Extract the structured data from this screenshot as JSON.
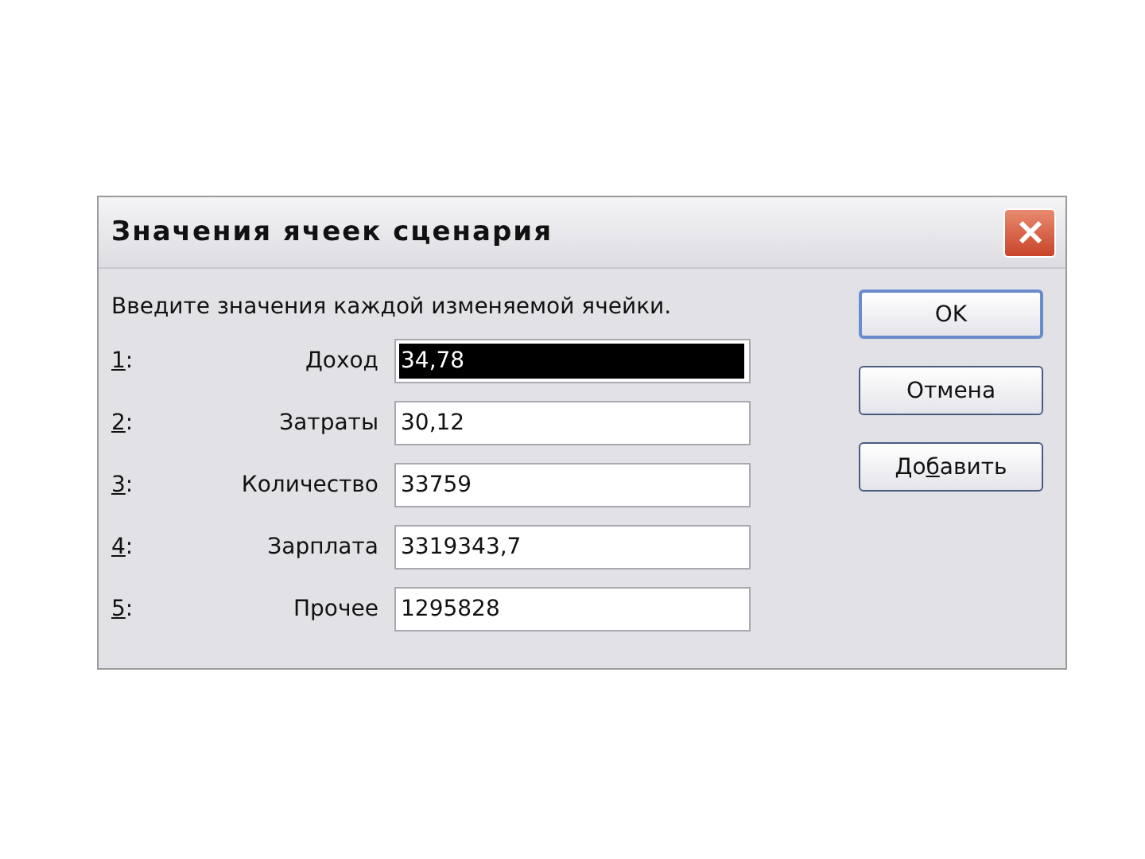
{
  "window": {
    "title": "Значения ячеек сценария"
  },
  "prompt": "Введите значения каждой изменяемой ячейки.",
  "cells": [
    {
      "hotkey": "1",
      "suffix": ":",
      "name": "Доход",
      "value": "34,78",
      "selected": true
    },
    {
      "hotkey": "2",
      "suffix": ":",
      "name": "Затраты",
      "value": "30,12",
      "selected": false
    },
    {
      "hotkey": "3",
      "suffix": ":",
      "name": "Количество",
      "value": "33759",
      "selected": false
    },
    {
      "hotkey": "4",
      "suffix": ":",
      "name": "Зарплата",
      "value": "3319343,7",
      "selected": false
    },
    {
      "hotkey": "5",
      "suffix": ":",
      "name": "Прочее",
      "value": "1295828",
      "selected": false
    }
  ],
  "buttons": [
    {
      "before": "OK",
      "default": true
    },
    {
      "before": "Отмена",
      "default": false
    },
    {
      "before": "До",
      "hotkey": "б",
      "after": "авить",
      "default": false
    }
  ]
}
